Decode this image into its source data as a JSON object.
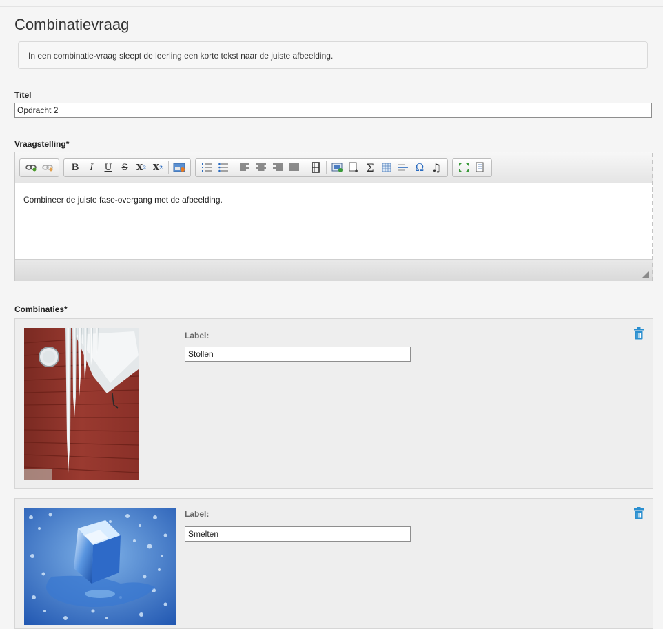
{
  "page": {
    "title": "Combinatievraag",
    "info": "In een combinatie-vraag sleept de leerling een korte tekst naar de juiste afbeelding."
  },
  "fields": {
    "titel_label": "Titel",
    "titel_value": "Opdracht 2",
    "vraagstelling_label": "Vraagstelling*",
    "combinaties_label": "Combinaties*"
  },
  "editor": {
    "content": "Combineer de juiste fase-overgang met de afbeelding.",
    "toolbar_groups": [
      [
        "link-icon",
        "unlink-icon"
      ],
      [
        "bold-icon",
        "italic-icon",
        "underline-icon",
        "strikethrough-icon",
        "subscript-icon",
        "superscript-icon",
        "|",
        "insert-image-icon"
      ],
      [
        "numbered-list-icon",
        "bulleted-list-icon",
        "|",
        "align-left-icon",
        "align-center-icon",
        "align-right-icon",
        "align-justify-icon",
        "|",
        "media-icon",
        "|",
        "image-manager-icon",
        "insert-page-icon",
        "formula-icon",
        "table-icon",
        "horizontal-rule-icon",
        "special-char-icon",
        "audio-icon"
      ],
      [
        "maximize-icon",
        "show-blocks-icon"
      ]
    ]
  },
  "combinations": [
    {
      "label_caption": "Label:",
      "value": "Stollen",
      "image": "icicles-on-red-wall"
    },
    {
      "label_caption": "Label:",
      "value": "Smelten",
      "image": "ice-cube-melting"
    }
  ],
  "colors": {
    "accent": "#2a8fd0",
    "background": "#f5f5f5",
    "panel": "#eeeeee"
  }
}
